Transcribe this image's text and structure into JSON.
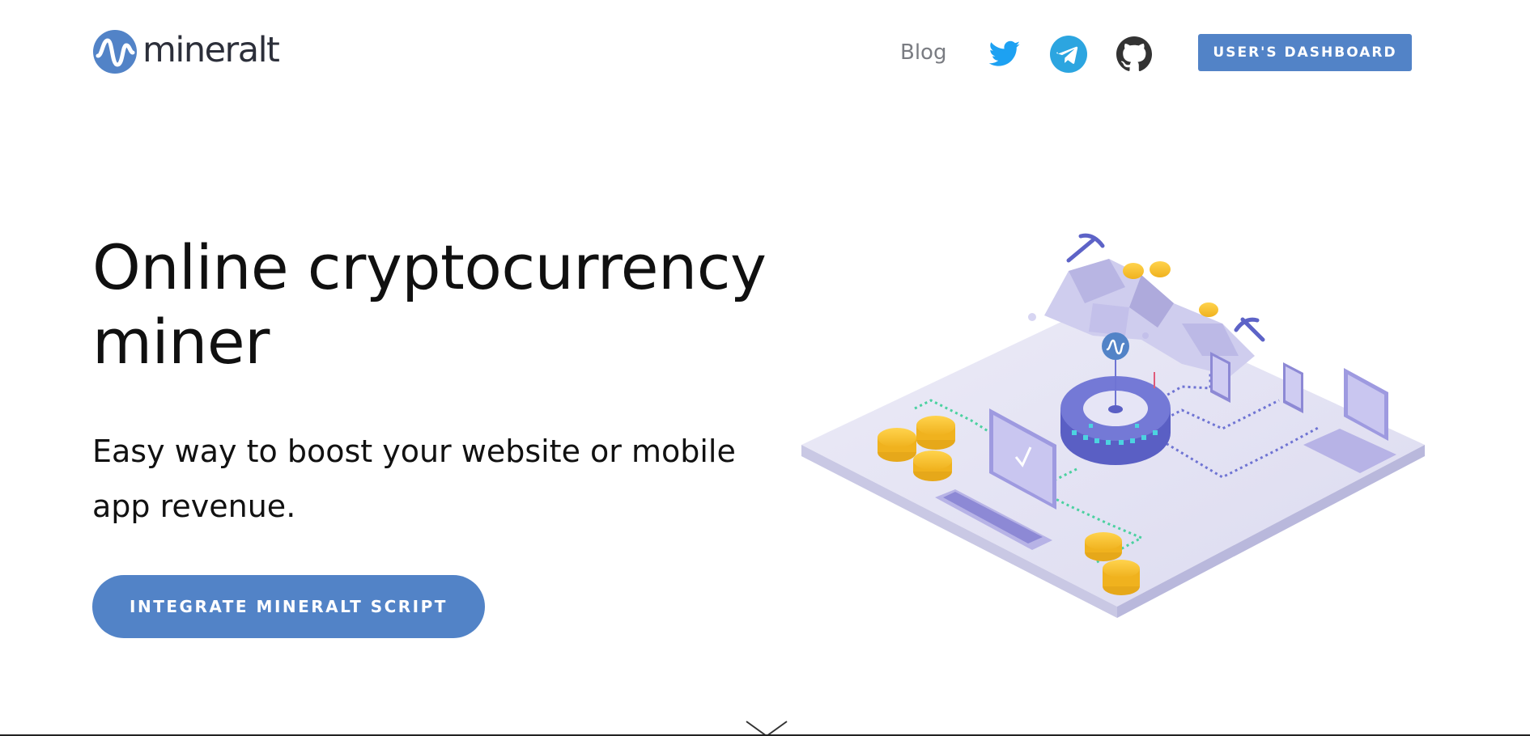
{
  "header": {
    "brand": "mineralt",
    "nav": {
      "blog_label": "Blog"
    },
    "social": [
      {
        "name": "twitter",
        "icon": "twitter-icon",
        "color": "#1da1f2"
      },
      {
        "name": "telegram",
        "icon": "telegram-icon",
        "color": "#2ca5e0"
      },
      {
        "name": "github",
        "icon": "github-icon",
        "color": "#333333"
      }
    ],
    "dashboard_button": "USER'S DASHBOARD"
  },
  "hero": {
    "title": "Online cryptocurrency miner",
    "subtitle": "Easy way to boost your website or mobile app revenue.",
    "cta_label": "INTEGRATE MINERALT SCRIPT"
  },
  "colors": {
    "accent": "#5283c7",
    "text": "#101010",
    "muted": "#7a7c82"
  }
}
